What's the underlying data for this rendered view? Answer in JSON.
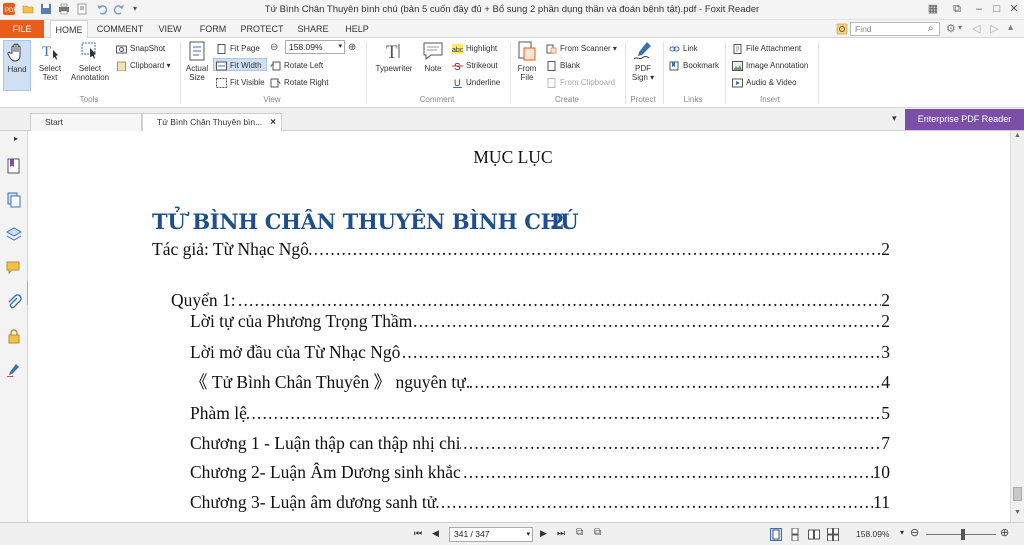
{
  "window": {
    "title": "Tứ Bình Chân Thuyên bình chú (bản 5 cuốn đầy đủ + Bổ sung 2 phần dụng thần và đoán bệnh tật).pdf - Foxit Reader"
  },
  "menu": {
    "file": "FILE",
    "tabs": [
      "HOME",
      "COMMENT",
      "VIEW",
      "FORM",
      "PROTECT",
      "SHARE",
      "HELP"
    ],
    "find_placeholder": "Find"
  },
  "ribbon": {
    "tools": {
      "label": "Tools",
      "hand": "Hand",
      "select_text": [
        "Select",
        "Text"
      ],
      "select_annotation": [
        "Select",
        "Annotation"
      ],
      "snapshot": "SnapShot",
      "clipboard": "Clipboard"
    },
    "view": {
      "label": "View",
      "actual_size": [
        "Actual",
        "Size"
      ],
      "fit_page": "Fit Page",
      "fit_width": "Fit Width",
      "fit_visible": "Fit Visible",
      "zoom": "158.09%",
      "rotate_left": "Rotate Left",
      "rotate_right": "Rotate Right"
    },
    "comment": {
      "label": "Comment",
      "typewriter": "Typewriter",
      "note": "Note",
      "highlight": "Highlight",
      "strikeout": "Strikeout",
      "underline": "Underline"
    },
    "create": {
      "label": "Create",
      "from_file": [
        "From",
        "File"
      ],
      "from_scanner": "From Scanner",
      "blank": "Blank",
      "from_clipboard": "From Clipboard"
    },
    "protect": {
      "label": "Protect",
      "pdf_sign": [
        "PDF",
        "Sign"
      ]
    },
    "links": {
      "label": "Links",
      "link": "Link",
      "bookmark": "Bookmark"
    },
    "insert": {
      "label": "Insert",
      "file_attachment": "File Attachment",
      "image_annotation": "Image Annotation",
      "audio_video": "Audio & Video"
    }
  },
  "tabs": {
    "start": "Start",
    "document": "Tứ Bình Chân Thuyên bìn...",
    "enterprise": "Enterprise PDF Reader"
  },
  "document": {
    "heading": "MỤC LỤC",
    "book_title": "TỬ BÌNH CHÂN THUYÊN BÌNH CHÚ",
    "book_title_page": "2",
    "entries": [
      {
        "text": "Tác giả: Từ Nhạc Ngô",
        "page": "2"
      },
      {
        "text": "Quyển 1: ",
        "page": "2"
      },
      {
        "text": "Lời tự của Phương Trọng Thầm",
        "page": "2"
      },
      {
        "text": "Lời mở đầu của Từ Nhạc Ngô ",
        "page": "3"
      },
      {
        "text": "《 Tử Bình Chân Thuyên 》 nguyên tự.",
        "page": "4"
      },
      {
        "text": "Phàm lệ ",
        "page": "5"
      },
      {
        "text": "Chương 1 - Luận thập can thập nhị chi ",
        "page": "7"
      },
      {
        "text": "Chương 2- Luận Âm Dương sinh khắc",
        "page": "10"
      },
      {
        "text": "Chương 3- Luận âm dương sanh tử",
        "page": "11"
      }
    ]
  },
  "status": {
    "page_indicator": "341 / 347",
    "zoom": "158.09%"
  },
  "colors": {
    "accent_orange": "#e85d1a",
    "title_blue": "#1f4e8c",
    "enterprise_purple": "#7b4fa8"
  }
}
